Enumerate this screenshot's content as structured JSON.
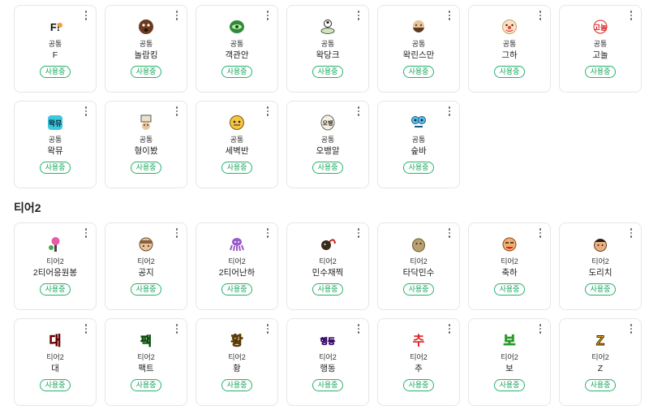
{
  "sections": [
    {
      "title": "",
      "items": [
        {
          "tier": "공통",
          "name": "F",
          "status": "사용중",
          "icon": "f-emote-icon"
        },
        {
          "tier": "공통",
          "name": "놀람킹",
          "status": "사용중",
          "icon": "surprised-face-emote-icon"
        },
        {
          "tier": "공통",
          "name": "객관안",
          "status": "사용중",
          "icon": "green-eye-emote-icon"
        },
        {
          "tier": "공통",
          "name": "왁당크",
          "status": "사용중",
          "icon": "soccer-face-emote-icon"
        },
        {
          "tier": "공통",
          "name": "왁린스만",
          "status": "사용중",
          "icon": "beard-face-emote-icon"
        },
        {
          "tier": "공통",
          "name": "그하",
          "status": "사용중",
          "icon": "clown-face-emote-icon"
        },
        {
          "tier": "공통",
          "name": "고놀",
          "status": "사용중",
          "icon": "red-text-emote-icon"
        },
        {
          "tier": "공통",
          "name": "왁뮤",
          "status": "사용중",
          "icon": "cyan-text-emote-icon"
        },
        {
          "tier": "공통",
          "name": "형이봤",
          "status": "사용중",
          "icon": "sign-face-emote-icon"
        },
        {
          "tier": "공통",
          "name": "세벽반",
          "status": "사용중",
          "icon": "yellow-face-emote-icon"
        },
        {
          "tier": "공통",
          "name": "오뱅알",
          "status": "사용중",
          "icon": "egg-face-emote-icon"
        },
        {
          "tier": "공통",
          "name": "숲바",
          "status": "사용중",
          "icon": "blue-eyes-emote-icon"
        }
      ]
    },
    {
      "title": "티어2",
      "items": [
        {
          "tier": "티어2",
          "name": "2티어응원봉",
          "status": "사용중",
          "icon": "lightstick-emote-icon"
        },
        {
          "tier": "티어2",
          "name": "공지",
          "status": "사용중",
          "icon": "notice-face-emote-icon"
        },
        {
          "tier": "티어2",
          "name": "2티어난하",
          "status": "사용중",
          "icon": "octopus-emote-icon"
        },
        {
          "tier": "티어2",
          "name": "민수채찍",
          "status": "사용중",
          "icon": "whip-emote-icon"
        },
        {
          "tier": "티어2",
          "name": "타닥민수",
          "status": "사용중",
          "icon": "potato-emote-icon"
        },
        {
          "tier": "티어2",
          "name": "축하",
          "status": "사용중",
          "icon": "celebrate-face-emote-icon"
        },
        {
          "tier": "티어2",
          "name": "도리치",
          "status": "사용중",
          "icon": "man-face-emote-icon"
        },
        {
          "tier": "티어2",
          "name": "대",
          "status": "사용중",
          "icon": "dae-text-emote-icon"
        },
        {
          "tier": "티어2",
          "name": "팩트",
          "status": "사용중",
          "icon": "fact-text-emote-icon"
        },
        {
          "tier": "티어2",
          "name": "황",
          "status": "사용중",
          "icon": "hwang-text-emote-icon"
        },
        {
          "tier": "티어2",
          "name": "행동",
          "status": "사용중",
          "icon": "haengdong-text-emote-icon"
        },
        {
          "tier": "티어2",
          "name": "추",
          "status": "사용중",
          "icon": "chu-text-emote-icon"
        },
        {
          "tier": "티어2",
          "name": "보",
          "status": "사용중",
          "icon": "bo-text-emote-icon"
        },
        {
          "tier": "티어2",
          "name": "Z",
          "status": "사용중",
          "icon": "z-text-emote-icon"
        }
      ]
    }
  ],
  "colors": {
    "accent": "#19a45f",
    "card_border": "#e6e6e6"
  }
}
